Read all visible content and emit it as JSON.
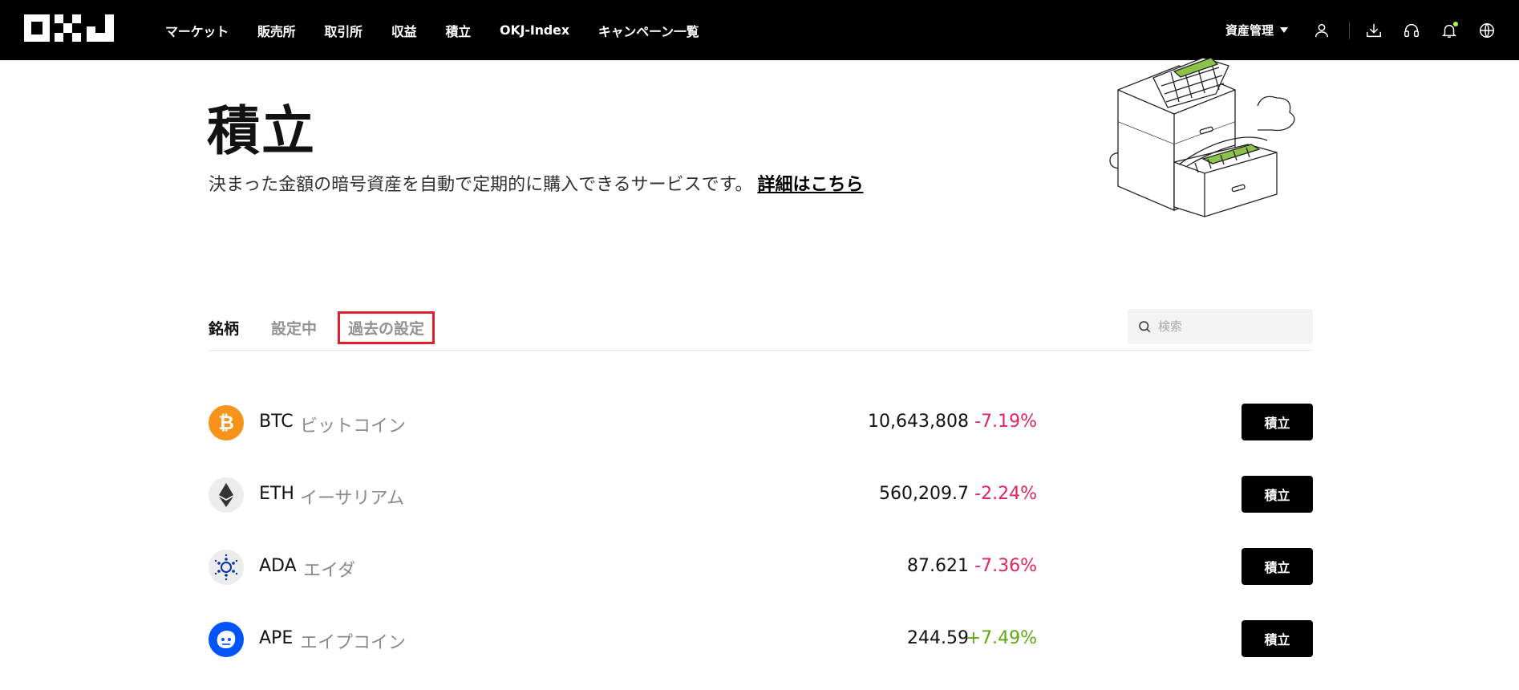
{
  "header": {
    "nav": [
      "マーケット",
      "販売所",
      "取引所",
      "収益",
      "積立",
      "OKJ-Index",
      "キャンペーン一覧"
    ],
    "asset_menu": "資産管理",
    "icons": [
      "user-icon",
      "download-icon",
      "headset-icon",
      "bell-icon",
      "globe-icon"
    ]
  },
  "hero": {
    "title": "積立",
    "description": "決まった金額の暗号資産を自動で定期的に購入できるサービスです。",
    "link": "詳細はこちら"
  },
  "tabs": [
    "銘柄",
    "設定中",
    "過去の設定"
  ],
  "search": {
    "placeholder": "検索"
  },
  "assets": [
    {
      "symbol": "BTC",
      "name": "ビットコイン",
      "price": "10,643,808",
      "change": "-7.19%",
      "direction": "down",
      "action": "積立",
      "icon": "btc-icon"
    },
    {
      "symbol": "ETH",
      "name": "イーサリアム",
      "price": "560,209.7",
      "change": "-2.24%",
      "direction": "down",
      "action": "積立",
      "icon": "eth-icon"
    },
    {
      "symbol": "ADA",
      "name": "エイダ",
      "price": "87.621",
      "change": "-7.36%",
      "direction": "down",
      "action": "積立",
      "icon": "ada-icon"
    },
    {
      "symbol": "APE",
      "name": "エイプコイン",
      "price": "244.59",
      "change": "+7.49%",
      "direction": "up",
      "action": "積立",
      "icon": "ape-icon"
    }
  ],
  "colors": {
    "topbar": "#000000",
    "negative": "#e0245e",
    "positive": "#5ea70f",
    "highlight_border": "#e0202e",
    "accent_green": "#b7f34b"
  }
}
